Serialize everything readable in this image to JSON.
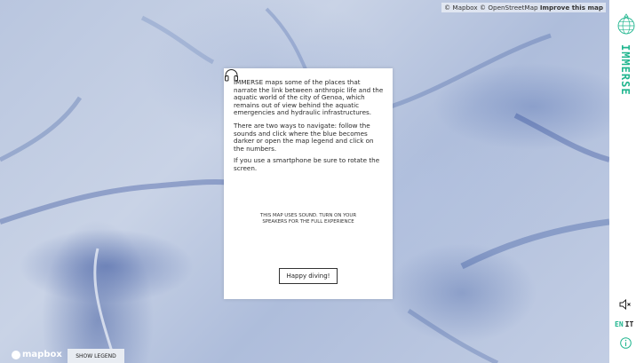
{
  "map": {
    "attribution_mapbox": "© Mapbox",
    "attribution_osm": "© OpenStreetMap",
    "improve_link": "Improve this map",
    "mapbox_logo_text": "mapbox",
    "show_legend": "SHOW LEGEND"
  },
  "modal": {
    "paragraph1": "IMMERSE maps some of the places that narrate the link between anthropic life and the aquatic world of the city of Genoa, which remains out of view behind the aquatic emergencies and hydraulic infrastructures.",
    "paragraph2": "There are two ways to navigate: follow the sounds and click where the blue becomes darker or open the map legend and click on the numbers.",
    "paragraph3": "If you use a smartphone be sure to rotate the screen.",
    "sound_note": "THIS MAP USES SOUND. TURN ON YOUR SPEAKERS FOR THE FULL EXPERIENCE",
    "button": "Happy diving!",
    "icon": "headphones-icon"
  },
  "sidebar": {
    "brand": "IMMERSE",
    "lang_en": "EN",
    "lang_it": "IT",
    "accent_color": "#21b68f",
    "icons": [
      "globe-logo-icon",
      "speaker-mute-icon",
      "info-icon"
    ]
  }
}
